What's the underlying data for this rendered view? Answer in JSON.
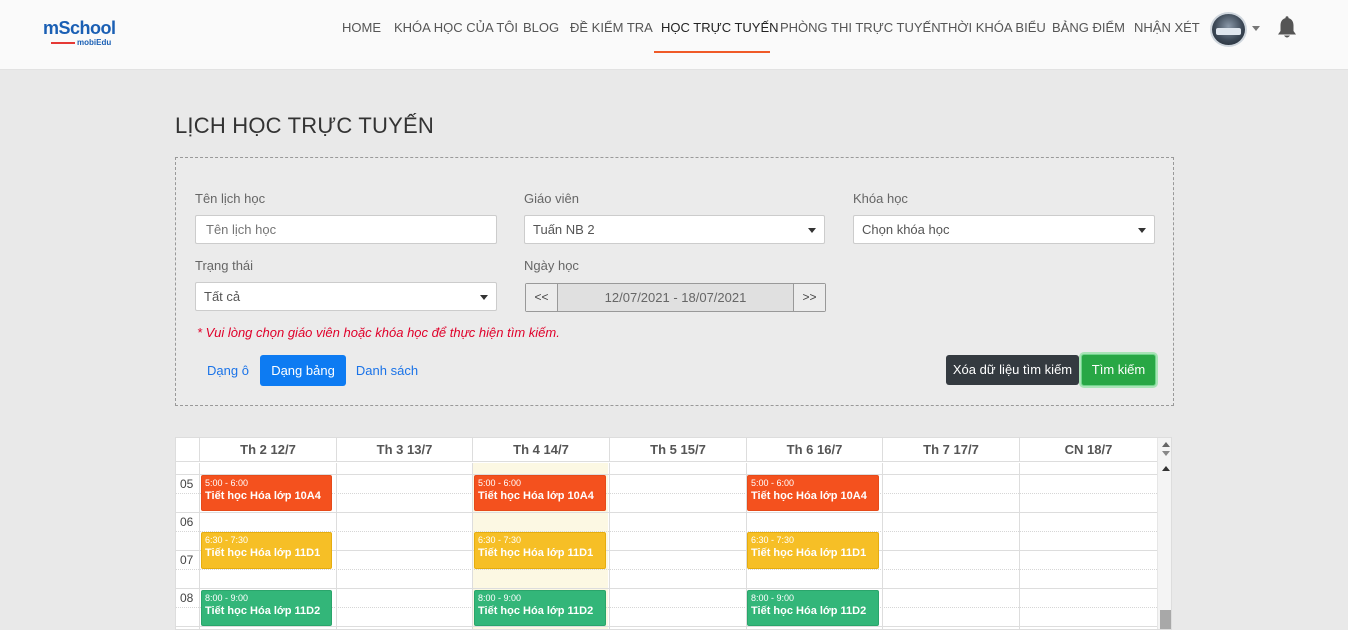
{
  "header": {
    "logo_main": "mSchool",
    "logo_sub": "mobiEdu",
    "nav": [
      {
        "label": "HOME",
        "active": false
      },
      {
        "label": "KHÓA HỌC CỦA TÔI",
        "active": false
      },
      {
        "label": "BLOG",
        "active": false
      },
      {
        "label": "ĐỀ KIỂM TRA",
        "active": false
      },
      {
        "label": "HỌC TRỰC TUYẾN",
        "active": true
      },
      {
        "label": "PHÒNG THI TRỰC TUYẾN",
        "active": false
      },
      {
        "label": "THỜI KHÓA BIỂU",
        "active": false
      },
      {
        "label": "BẢNG ĐIỂM",
        "active": false
      },
      {
        "label": "NHẬN XÉT",
        "active": false
      }
    ],
    "accent_color": "#f05a28"
  },
  "page": {
    "title": "LỊCH HỌC TRỰC TUYẾN"
  },
  "filters": {
    "schedule_name": {
      "label": "Tên lịch học",
      "placeholder": "Tên lịch học",
      "value": ""
    },
    "teacher": {
      "label": "Giáo viên",
      "value": "Tuấn NB 2"
    },
    "course": {
      "label": "Khóa học",
      "value": "Chọn khóa học"
    },
    "status": {
      "label": "Trạng thái",
      "value": "Tất cả"
    },
    "date": {
      "label": "Ngày học",
      "prev": "<<",
      "next": ">>",
      "range": "12/07/2021 - 18/07/2021"
    },
    "warning": "* Vui lòng chọn giáo viên hoặc khóa học để thực hiện tìm kiếm.",
    "views": {
      "grid": "Dạng ô",
      "table": "Dạng bảng",
      "list": "Danh sách"
    },
    "clear_label": "Xóa dữ liệu tìm kiếm",
    "search_label": "Tìm kiếm"
  },
  "calendar": {
    "days": [
      "Th 2 12/7",
      "Th 3 13/7",
      "Th 4 14/7",
      "Th 5 15/7",
      "Th 6 16/7",
      "Th 7 17/7",
      "CN 18/7"
    ],
    "hours": [
      "05",
      "06",
      "07",
      "08"
    ],
    "events": [
      {
        "day": 0,
        "time": "5:00 - 6:00",
        "title": "Tiết học Hóa lớp 10A4",
        "color": "red"
      },
      {
        "day": 2,
        "time": "5:00 - 6:00",
        "title": "Tiết học Hóa lớp 10A4",
        "color": "red"
      },
      {
        "day": 4,
        "time": "5:00 - 6:00",
        "title": "Tiết học Hóa lớp 10A4",
        "color": "red"
      },
      {
        "day": 0,
        "time": "6:30 - 7:30",
        "title": "Tiết học Hóa lớp 11D1",
        "color": "yellow"
      },
      {
        "day": 2,
        "time": "6:30 - 7:30",
        "title": "Tiết học Hóa lớp 11D1",
        "color": "yellow"
      },
      {
        "day": 4,
        "time": "6:30 - 7:30",
        "title": "Tiết học Hóa lớp 11D1",
        "color": "yellow"
      },
      {
        "day": 0,
        "time": "8:00 - 9:00",
        "title": "Tiết học Hóa lớp 11D2",
        "color": "green"
      },
      {
        "day": 2,
        "time": "8:00 - 9:00",
        "title": "Tiết học Hóa lớp 11D2",
        "color": "green"
      },
      {
        "day": 4,
        "time": "8:00 - 9:00",
        "title": "Tiết học Hóa lớp 11D2",
        "color": "green"
      }
    ]
  }
}
